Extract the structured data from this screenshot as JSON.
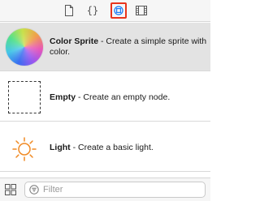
{
  "toolbar": {
    "tabs": [
      {
        "icon": "file-icon",
        "selected": false
      },
      {
        "icon": "braces-icon",
        "selected": false
      },
      {
        "icon": "object-library-icon",
        "selected": true
      },
      {
        "icon": "media-library-icon",
        "selected": false
      }
    ],
    "accent": "#e8341c",
    "selected_icon_color": "#1a7cf5"
  },
  "library": {
    "items": [
      {
        "icon": "color-sphere-icon",
        "name": "Color Sprite",
        "description": " - Create a simple sprite with color.",
        "selected": true
      },
      {
        "icon": "dashed-box-icon",
        "name": "Empty",
        "description": " - Create an empty node.",
        "selected": false
      },
      {
        "icon": "sun-light-icon",
        "name": "Light",
        "description": " - Create a basic light.",
        "selected": false
      }
    ]
  },
  "footer": {
    "grid_icon": "grid-view-icon",
    "filter_icon": "filter-icon",
    "filter_placeholder": "Filter",
    "filter_value": ""
  },
  "colors": {
    "light_orange": "#f08a24",
    "row_selected_bg": "#e3e3e3"
  }
}
